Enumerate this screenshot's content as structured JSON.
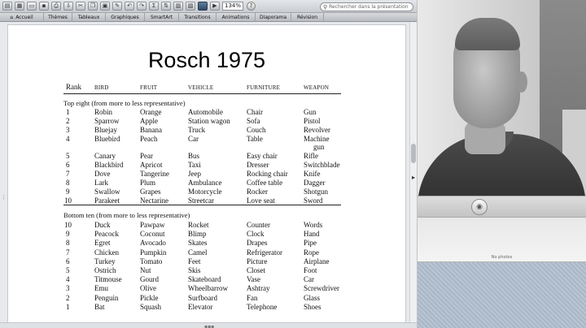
{
  "toolbar": {
    "zoom_value": "134%",
    "search_placeholder": "Rechercher dans la présentation",
    "help_label": "?"
  },
  "ribbon": {
    "tabs": [
      "Accueil",
      "Thèmes",
      "Tableaux",
      "Graphiques",
      "SmartArt",
      "Transitions",
      "Animations",
      "Diaporama",
      "Révision"
    ]
  },
  "slide": {
    "title": "Rosch 1975",
    "headers": [
      "Rank",
      "BIRD",
      "FRUIT",
      "VEHICLE",
      "FURNITURE",
      "WEAPON"
    ],
    "section_top": "Top eight (from more to less representative)",
    "section_bottom": "Bottom ten (from more to less representative)",
    "top_rows": [
      [
        "1",
        "Robin",
        "Orange",
        "Automobile",
        "Chair",
        "Gun"
      ],
      [
        "2",
        "Sparrow",
        "Apple",
        "Station wagon",
        "Sofa",
        "Pistol"
      ],
      [
        "3",
        "Bluejay",
        "Banana",
        "Truck",
        "Couch",
        "Revolver"
      ],
      [
        "4",
        "Bluebird",
        "Peach",
        "Car",
        "Table",
        "Machine"
      ],
      [
        "",
        "",
        "",
        "",
        "",
        "gun"
      ],
      [
        "5",
        "Canary",
        "Pear",
        "Bus",
        "Easy chair",
        "Rifle"
      ],
      [
        "6",
        "Blackbird",
        "Apricot",
        "Taxi",
        "Dresser",
        "Switchblade"
      ],
      [
        "7",
        "Dove",
        "Tangerine",
        "Jeep",
        "Rocking chair",
        "Knife"
      ],
      [
        "8",
        "Lark",
        "Plum",
        "Ambulance",
        "Coffee table",
        "Dagger"
      ],
      [
        "9",
        "Swallow",
        "Grapes",
        "Motorcycle",
        "Rocker",
        "Shotgun"
      ],
      [
        "10",
        "Parakeet",
        "Nectarine",
        "Streetcar",
        "Love seat",
        "Sword"
      ]
    ],
    "bottom_rows": [
      [
        "10",
        "Duck",
        "Pawpaw",
        "Rocket",
        "Counter",
        "Words"
      ],
      [
        "9",
        "Peacock",
        "Coconut",
        "Blimp",
        "Clock",
        "Hand"
      ],
      [
        "8",
        "Egret",
        "Avocado",
        "Skates",
        "Drapes",
        "Pipe"
      ],
      [
        "7",
        "Chicken",
        "Pumpkin",
        "Camel",
        "Refrigerator",
        "Rope"
      ],
      [
        "6",
        "Turkey",
        "Tomato",
        "Feet",
        "Picture",
        "Airplane"
      ],
      [
        "5",
        "Ostrich",
        "Nut",
        "Skis",
        "Closet",
        "Foot"
      ],
      [
        "4",
        "Titmouse",
        "Gourd",
        "Skateboard",
        "Vase",
        "Car"
      ],
      [
        "3",
        "Emu",
        "Olive",
        "Wheelbarrow",
        "Ashtray",
        "Screwdriver"
      ],
      [
        "2",
        "Penguin",
        "Pickle",
        "Surfboard",
        "Fan",
        "Glass"
      ],
      [
        "1",
        "Bat",
        "Squash",
        "Elevator",
        "Telephone",
        "Shoes"
      ]
    ]
  },
  "photobooth": {
    "no_photos_label": "No photos",
    "camera_icon": "camera-icon"
  }
}
